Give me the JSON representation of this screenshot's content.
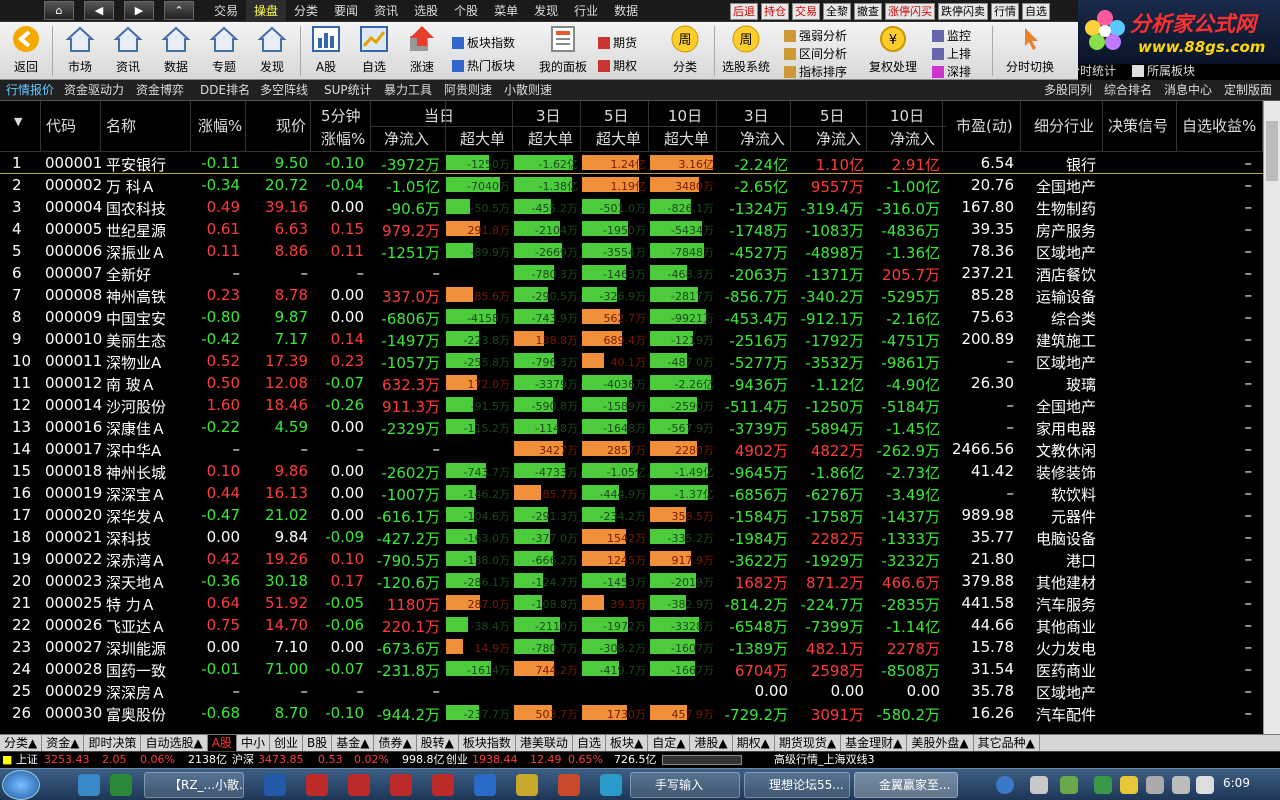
{
  "menubar": {
    "nav": [
      "⌂",
      "◀",
      "▶",
      "⌃"
    ],
    "menu": [
      "交易",
      "操盘",
      "分类",
      "要闻",
      "资讯",
      "选股",
      "个股",
      "菜单",
      "发现",
      "行业",
      "数据"
    ],
    "active_menu": "操盘",
    "quick": [
      "后退",
      "持仓",
      "交易",
      "全黎",
      "撤查",
      "涨停闪买",
      "跌停闪卖",
      "行情",
      "自选"
    ]
  },
  "logo": {
    "title": "分析家公式网",
    "url": "www.88gs.com"
  },
  "toolbar": {
    "back": "返回",
    "big": [
      "市场",
      "资讯",
      "数据",
      "专题",
      "发现",
      "A股",
      "自选",
      "涨速"
    ],
    "small_a": [
      "板块指数",
      "热门板块"
    ],
    "panel": "我的面板",
    "small_b": [
      "期货",
      "期权"
    ],
    "fenlei": "分类",
    "xuangu": "选股系统",
    "small_c": [
      "强弱分析",
      "区间分析",
      "指标排序"
    ],
    "fuquan": "复权处理",
    "small_d": [
      "监控",
      "上排",
      "深排"
    ],
    "fenshi": "分时切换",
    "fentong": "分时统计",
    "small_e": "所属板块"
  },
  "tabrow": {
    "left": [
      "行情报价",
      "资金驱动力",
      "资金博弈",
      "DDE排名",
      "多空阵线",
      "SUP统计",
      "暴力工具",
      "阿贵则速",
      "小散则速"
    ],
    "right": [
      "多股同列",
      "综合排名",
      "消息中心",
      "定制版面"
    ]
  },
  "headers": {
    "code": "代码",
    "name": "名称",
    "chg": "涨幅%",
    "price": "现价",
    "m5_top": "5分钟",
    "m5_bot": "涨幅%",
    "today": "当日",
    "d3": "3日",
    "d5": "5日",
    "d10": "10日",
    "netin": "净流入",
    "big": "超大单",
    "d3b": "3日",
    "d5b": "5日",
    "d10b": "10日",
    "pe": "市盈(动)",
    "industry": "细分行业",
    "signal": "决策信号",
    "profit": "自选收益%"
  },
  "rows": [
    {
      "n": "1",
      "code": "000001",
      "name": "平安银行",
      "chg": "-0.11",
      "price": "9.50",
      "m5": "-0.10",
      "net": "-3972万",
      "b0": "-1250万",
      "b1": "-1.62亿",
      "b2": "1.24亿",
      "b3": "3.16亿",
      "n3": "-2.24亿",
      "n5": "1.10亿",
      "n10": "2.91亿",
      "pe": "6.54",
      "ind": "银行",
      "pf": "–"
    },
    {
      "n": "2",
      "code": "000002",
      "name": "万 科Ａ",
      "chg": "-0.34",
      "price": "20.72",
      "m5": "-0.04",
      "net": "-1.05亿",
      "b0": "-7040万",
      "b1": "-1.38亿",
      "b2": "1.19亿",
      "b3": "3480万",
      "n3": "-2.65亿",
      "n5": "9557万",
      "n10": "-1.00亿",
      "pe": "20.76",
      "ind": "全国地产",
      "pf": "–"
    },
    {
      "n": "3",
      "code": "000004",
      "name": "国农科技",
      "chg": "0.49",
      "price": "39.16",
      "m5": "0.00",
      "net": "-90.6万",
      "b0": "-50.5万",
      "b1": "-455.2万",
      "b2": "-501.0万",
      "b3": "-826.1万",
      "n3": "-1324万",
      "n5": "-319.4万",
      "n10": "-316.0万",
      "pe": "167.80",
      "ind": "生物制药",
      "pf": "–"
    },
    {
      "n": "4",
      "code": "000005",
      "name": "世纪星源",
      "chg": "0.61",
      "price": "6.63",
      "m5": "0.15",
      "net": "979.2万",
      "b0": "291.8万",
      "b1": "-2104万",
      "b2": "-1950万",
      "b3": "-5434万",
      "n3": "-1748万",
      "n5": "-1083万",
      "n10": "-4836万",
      "pe": "39.35",
      "ind": "房产服务",
      "pf": "–"
    },
    {
      "n": "5",
      "code": "000006",
      "name": "深振业Ａ",
      "chg": "0.11",
      "price": "8.86",
      "m5": "0.11",
      "net": "-1251万",
      "b0": "-89.9万",
      "b1": "-2669万",
      "b2": "-3554万",
      "b3": "-7848万",
      "n3": "-4527万",
      "n5": "-4898万",
      "n10": "-1.36亿",
      "pe": "78.36",
      "ind": "区域地产",
      "pf": "–"
    },
    {
      "n": "6",
      "code": "000007",
      "name": "全新好",
      "chg": "–",
      "price": "–",
      "m5": "–",
      "net": "–",
      "b0": "",
      "b1": "-780.3万",
      "b2": "-1463万",
      "b3": "-468.3万",
      "n3": "-2063万",
      "n5": "-1371万",
      "n10": "205.7万",
      "pe": "237.21",
      "ind": "酒店餐饮",
      "pf": "–"
    },
    {
      "n": "7",
      "code": "000008",
      "name": "神州高铁",
      "chg": "0.23",
      "price": "8.78",
      "m5": "0.00",
      "net": "337.0万",
      "b0": "85.6万",
      "b1": "-290.5万",
      "b2": "-326.9万",
      "b3": "-2817万",
      "n3": "-856.7万",
      "n5": "-340.2万",
      "n10": "-5295万",
      "pe": "85.28",
      "ind": "运输设备",
      "pf": "–"
    },
    {
      "n": "8",
      "code": "000009",
      "name": "中国宝安",
      "chg": "-0.80",
      "price": "9.87",
      "m5": "0.00",
      "net": "-6806万",
      "b0": "-4158万",
      "b1": "-743.9万",
      "b2": "562.7万",
      "b3": "-9921万",
      "n3": "-453.4万",
      "n5": "-912.1万",
      "n10": "-2.16亿",
      "pe": "75.63",
      "ind": "综合类",
      "pf": "–"
    },
    {
      "n": "9",
      "code": "000010",
      "name": "美丽生态",
      "chg": "-0.42",
      "price": "7.17",
      "m5": "0.14",
      "net": "-1497万",
      "b0": "-223.8万",
      "b1": "138.8万",
      "b2": "689.4万",
      "b3": "-1219万",
      "n3": "-2516万",
      "n5": "-1792万",
      "n10": "-4751万",
      "pe": "200.89",
      "ind": "建筑施工",
      "pf": "–"
    },
    {
      "n": "10",
      "code": "000011",
      "name": "深物业A",
      "chg": "0.52",
      "price": "17.39",
      "m5": "0.23",
      "net": "-1057万",
      "b0": "-255.8万",
      "b1": "-796.3万",
      "b2": "40.1万",
      "b3": "-487.0万",
      "n3": "-5277万",
      "n5": "-3532万",
      "n10": "-9861万",
      "pe": "–",
      "ind": "区域地产",
      "pf": "–"
    },
    {
      "n": "11",
      "code": "000012",
      "name": "南 玻Ａ",
      "chg": "0.50",
      "price": "12.08",
      "m5": "-0.07",
      "net": "632.3万",
      "b0": "172.0万",
      "b1": "-3379万",
      "b2": "-4036万",
      "b3": "-2.26亿",
      "n3": "-9436万",
      "n5": "-1.12亿",
      "n10": "-4.90亿",
      "pe": "26.30",
      "ind": "玻璃",
      "pf": "–"
    },
    {
      "n": "12",
      "code": "000014",
      "name": "沙河股份",
      "chg": "1.60",
      "price": "18.46",
      "m5": "-0.26",
      "net": "911.3万",
      "b0": "-91.5万",
      "b1": "-590.8万",
      "b2": "-1589万",
      "b3": "-2590万",
      "n3": "-511.4万",
      "n5": "-1250万",
      "n10": "-5184万",
      "pe": "–",
      "ind": "全国地产",
      "pf": "–"
    },
    {
      "n": "13",
      "code": "000016",
      "name": "深康佳Ａ",
      "chg": "-0.22",
      "price": "4.59",
      "m5": "0.00",
      "net": "-2329万",
      "b0": "-115.2万",
      "b1": "-1148万",
      "b2": "-1648万",
      "b3": "-567.9万",
      "n3": "-3739万",
      "n5": "-5894万",
      "n10": "-1.45亿",
      "pe": "–",
      "ind": "家用电器",
      "pf": "–"
    },
    {
      "n": "14",
      "code": "000017",
      "name": "深中华A",
      "chg": "–",
      "price": "–",
      "m5": "–",
      "net": "–",
      "b0": "",
      "b1": "3427万",
      "b2": "2857万",
      "b3": "2280万",
      "n3": "4902万",
      "n5": "4822万",
      "n10": "-262.9万",
      "pe": "2466.56",
      "ind": "文教休闲",
      "pf": "–"
    },
    {
      "n": "15",
      "code": "000018",
      "name": "神州长城",
      "chg": "0.10",
      "price": "9.86",
      "m5": "0.00",
      "net": "-2602万",
      "b0": "-743.7万",
      "b1": "-4733万",
      "b2": "-1.05亿",
      "b3": "-1.49亿",
      "n3": "-9645万",
      "n5": "-1.86亿",
      "n10": "-2.73亿",
      "pe": "41.42",
      "ind": "装修装饰",
      "pf": "–"
    },
    {
      "n": "16",
      "code": "000019",
      "name": "深深宝Ａ",
      "chg": "0.44",
      "price": "16.13",
      "m5": "0.00",
      "net": "-1007万",
      "b0": "-146.2万",
      "b1": "85.7万",
      "b2": "-444.9万",
      "b3": "-1.37亿",
      "n3": "-6856万",
      "n5": "-6276万",
      "n10": "-3.49亿",
      "pe": "–",
      "ind": "软饮料",
      "pf": "–"
    },
    {
      "n": "17",
      "code": "000020",
      "name": "深华发Ａ",
      "chg": "-0.47",
      "price": "21.02",
      "m5": "0.00",
      "net": "-616.1万",
      "b0": "-104.6万",
      "b1": "-291.3万",
      "b2": "-234.2万",
      "b3": "358.5万",
      "n3": "-1584万",
      "n5": "-1758万",
      "n10": "-1437万",
      "pe": "989.98",
      "ind": "元器件",
      "pf": "–"
    },
    {
      "n": "18",
      "code": "000021",
      "name": "深科技",
      "chg": "0.00",
      "price": "9.84",
      "m5": "-0.09",
      "net": "-427.2万",
      "b0": "-163.0万",
      "b1": "-377.0万",
      "b2": "1542万",
      "b3": "-335.2万",
      "n3": "-1984万",
      "n5": "2282万",
      "n10": "-1333万",
      "pe": "35.77",
      "ind": "电脑设备",
      "pf": "–"
    },
    {
      "n": "19",
      "code": "000022",
      "name": "深赤湾Ａ",
      "chg": "0.42",
      "price": "19.26",
      "m5": "0.10",
      "net": "-790.5万",
      "b0": "-138.0万",
      "b1": "-666.2万",
      "b2": "1245万",
      "b3": "917.9万",
      "n3": "-3622万",
      "n5": "-1929万",
      "n10": "-3232万",
      "pe": "21.80",
      "ind": "港口",
      "pf": "–"
    },
    {
      "n": "20",
      "code": "000023",
      "name": "深天地Ａ",
      "chg": "-0.36",
      "price": "30.18",
      "m5": "0.17",
      "net": "-120.6万",
      "b0": "-286.1万",
      "b1": "-124.7万",
      "b2": "-1453万",
      "b3": "-2019万",
      "n3": "1682万",
      "n5": "871.2万",
      "n10": "466.6万",
      "pe": "379.88",
      "ind": "其他建材",
      "pf": "–"
    },
    {
      "n": "21",
      "code": "000025",
      "name": "特 力Ａ",
      "chg": "0.64",
      "price": "51.92",
      "m5": "-0.05",
      "net": "1180万",
      "b0": "287.0万",
      "b1": "-108.8万",
      "b2": "39.3万",
      "b3": "-382.9万",
      "n3": "-814.2万",
      "n5": "-224.7万",
      "n10": "-2835万",
      "pe": "441.58",
      "ind": "汽车服务",
      "pf": "–"
    },
    {
      "n": "22",
      "code": "000026",
      "name": "飞亚达Ａ",
      "chg": "0.75",
      "price": "14.70",
      "m5": "-0.06",
      "net": "220.1万",
      "b0": "-38.4万",
      "b1": "-2110万",
      "b2": "-1972万",
      "b3": "-3328万",
      "n3": "-6548万",
      "n5": "-7399万",
      "n10": "-1.14亿",
      "pe": "44.66",
      "ind": "其他商业",
      "pf": "–"
    },
    {
      "n": "23",
      "code": "000027",
      "name": "深圳能源",
      "chg": "0.00",
      "price": "7.10",
      "m5": "0.00",
      "net": "-673.6万",
      "b0": "14.9万",
      "b1": "-780.7万",
      "b2": "-308.2万",
      "b3": "-1607万",
      "n3": "-1389万",
      "n5": "482.1万",
      "n10": "2278万",
      "pe": "15.78",
      "ind": "火力发电",
      "pf": "–"
    },
    {
      "n": "24",
      "code": "000028",
      "name": "国药一致",
      "chg": "-0.01",
      "price": "71.00",
      "m5": "-0.07",
      "net": "-231.8万",
      "b0": "-1614万",
      "b1": "744.2万",
      "b2": "-419.7万",
      "b3": "-1667万",
      "n3": "6704万",
      "n5": "2598万",
      "n10": "-8508万",
      "pe": "31.54",
      "ind": "医药商业",
      "pf": "–"
    },
    {
      "n": "25",
      "code": "000029",
      "name": "深深房Ａ",
      "chg": "–",
      "price": "–",
      "m5": "–",
      "net": "–",
      "b0": "",
      "b1": "",
      "b2": "",
      "b3": "",
      "n3": "0.00",
      "n5": "0.00",
      "n10": "0.00",
      "pe": "35.78",
      "ind": "区域地产",
      "pf": "–"
    },
    {
      "n": "26",
      "code": "000030",
      "name": "富奥股份",
      "chg": "-0.68",
      "price": "8.70",
      "m5": "-0.10",
      "net": "-944.2万",
      "b0": "-237.7万",
      "b1": "503.7万",
      "b2": "1730万",
      "b3": "457.9万",
      "n3": "-729.2万",
      "n5": "3091万",
      "n10": "-580.2万",
      "pe": "16.26",
      "ind": "汽车配件",
      "pf": "–"
    }
  ],
  "bottom_tabs": [
    "分类▲",
    "资金▲",
    "即时决策",
    "自动选股▲",
    "A股",
    "中小",
    "创业",
    "B股",
    "基金▲",
    "债券▲",
    "股转▲",
    "板块指数",
    "港美联动",
    "自选",
    "板块▲",
    "自定▲",
    "港股▲",
    "期权▲",
    "期货现货▲",
    "基金理财▲",
    "美股外盘▲",
    "其它品种▲"
  ],
  "active_bottom_tab": "A股",
  "status": {
    "sh_label": "上证",
    "sh_val": "3253.43",
    "sh_chg": "2.05",
    "sh_pct": "0.06%",
    "sh_amt": "2138亿",
    "sz_label": "沪深",
    "sz_val": "3473.85",
    "sz_chg": "0.53",
    "sz_pct": "0.02%",
    "sz_amt": "998.8亿",
    "cy_label": "创业",
    "cy_val": "1938.44",
    "cy_chg": "12.49",
    "cy_pct": "0.65%",
    "cy_amt": "726.5亿",
    "right": "高级行情_上海双线3"
  },
  "taskbar": {
    "items": [
      "【RZ_...小散...",
      "手写输入",
      "理想论坛55...",
      "金翼赢家至..."
    ],
    "time": "6:09"
  },
  "colors": {
    "up": "#ff3c3c",
    "down": "#3ce83c",
    "bar_green": "#4ccc3c",
    "bar_orange": "#f0903a"
  }
}
